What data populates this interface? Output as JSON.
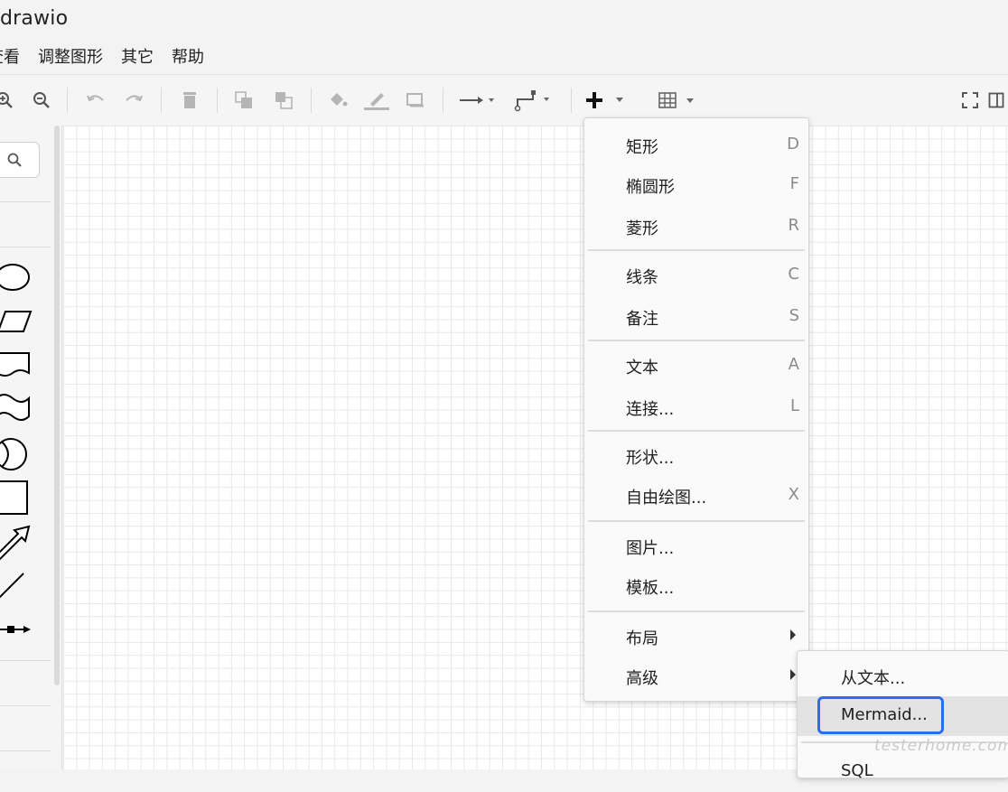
{
  "window": {
    "title": "drawio"
  },
  "menubar": {
    "items": [
      "查看",
      "调整图形",
      "其它",
      "帮助"
    ]
  },
  "toolbar": {
    "buttons": [
      "zoom-in-icon",
      "zoom-out-icon",
      "undo-icon",
      "redo-icon",
      "delete-icon",
      "to-front-icon",
      "to-back-icon",
      "fill-color-icon",
      "line-color-icon",
      "shadow-icon",
      "connection-icon",
      "waypoints-icon",
      "insert-icon",
      "table-icon",
      "fullscreen-icon",
      "format-panel-icon"
    ],
    "colors": {
      "icon": "#555555",
      "disabled": "#b5b5b5"
    }
  },
  "sidebar": {
    "search_icon": "search-icon",
    "shapes": [
      "ellipse-shape",
      "parallelogram-shape",
      "document-shape",
      "tape-shape",
      "or-shape",
      "square-shape",
      "arrow-shape",
      "line-shape",
      "connector-shape"
    ]
  },
  "insert_menu": {
    "items": [
      {
        "label": "矩形",
        "shortcut": "D"
      },
      {
        "label": "椭圆形",
        "shortcut": "F"
      },
      {
        "label": "菱形",
        "shortcut": "R"
      },
      {
        "label": "线条",
        "shortcut": "C"
      },
      {
        "label": "备注",
        "shortcut": "S"
      },
      {
        "label": "文本",
        "shortcut": "A"
      },
      {
        "label": "连接...",
        "shortcut": "L"
      },
      {
        "label": "形状...",
        "shortcut": ""
      },
      {
        "label": "自由绘图...",
        "shortcut": "X"
      },
      {
        "label": "图片...",
        "shortcut": ""
      },
      {
        "label": "模板...",
        "shortcut": ""
      },
      {
        "label": "布局",
        "shortcut": ""
      },
      {
        "label": "高级",
        "shortcut": ""
      }
    ]
  },
  "advanced_submenu": {
    "items": [
      {
        "label": "从文本..."
      },
      {
        "label": "Mermaid..."
      },
      {
        "label": "SQL"
      }
    ],
    "highlight_color": "#2b6cf0"
  },
  "watermark": "testerhome.com"
}
